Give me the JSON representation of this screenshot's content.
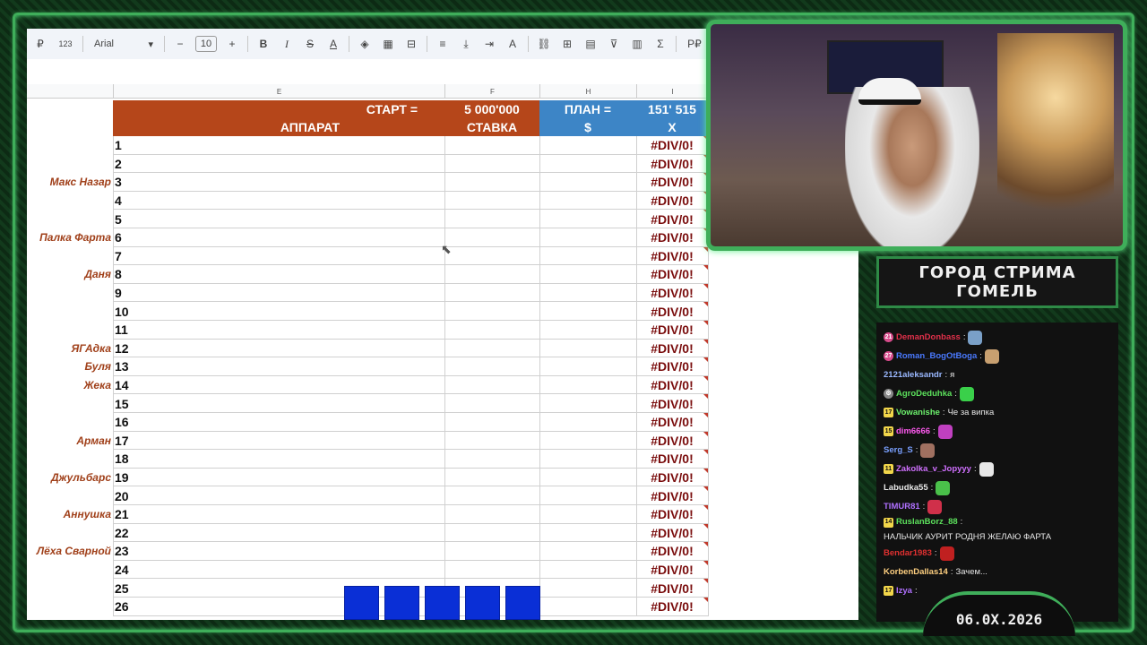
{
  "toolbar": {
    "format_label": "123",
    "font": "Arial",
    "font_size": "10",
    "currency_label": "Р₽",
    "sigma": "Σ"
  },
  "columns": [
    "E",
    "F",
    "H",
    "I"
  ],
  "sheet_header": {
    "start_label": "СТАРТ =",
    "start_value": "5 000'000",
    "plan_label": "ПЛАН =",
    "plan_value": "151' 515",
    "col_apparat": "АППАРАТ",
    "col_stavka": "СТАВКА",
    "col_dollar": "$",
    "col_x": "X"
  },
  "rows": [
    {
      "num": "1",
      "x": "#DIV/0!"
    },
    {
      "num": "2",
      "x": "#DIV/0!"
    },
    {
      "num": "3",
      "x": "#DIV/0!"
    },
    {
      "num": "4",
      "x": "#DIV/0!"
    },
    {
      "num": "5",
      "x": "#DIV/0!"
    },
    {
      "num": "6",
      "x": "#DIV/0!"
    },
    {
      "num": "7",
      "x": "#DIV/0!"
    },
    {
      "num": "8",
      "x": "#DIV/0!"
    },
    {
      "num": "9",
      "x": "#DIV/0!"
    },
    {
      "num": "10",
      "x": "#DIV/0!"
    },
    {
      "num": "11",
      "x": "#DIV/0!"
    },
    {
      "num": "12",
      "x": "#DIV/0!"
    },
    {
      "num": "13",
      "x": "#DIV/0!"
    },
    {
      "num": "14",
      "x": "#DIV/0!"
    },
    {
      "num": "15",
      "x": "#DIV/0!"
    },
    {
      "num": "16",
      "x": "#DIV/0!"
    },
    {
      "num": "17",
      "x": "#DIV/0!"
    },
    {
      "num": "18",
      "x": "#DIV/0!"
    },
    {
      "num": "19",
      "x": "#DIV/0!"
    },
    {
      "num": "20",
      "x": "#DIV/0!"
    },
    {
      "num": "21",
      "x": "#DIV/0!"
    },
    {
      "num": "22",
      "x": "#DIV/0!"
    },
    {
      "num": "23",
      "x": "#DIV/0!"
    },
    {
      "num": "24",
      "x": "#DIV/0!"
    },
    {
      "num": "25",
      "x": "#DIV/0!"
    },
    {
      "num": "26",
      "x": "#DIV/0!"
    }
  ],
  "names": [
    {
      "row": 3,
      "name": "Макс Назар"
    },
    {
      "row": 6,
      "name": "Палка Фарта"
    },
    {
      "row": 8,
      "name": "Даня"
    },
    {
      "row": 12,
      "name": "ЯГАдка"
    },
    {
      "row": 13,
      "name": "Буля"
    },
    {
      "row": 14,
      "name": "Жека"
    },
    {
      "row": 17,
      "name": "Арман"
    },
    {
      "row": 19,
      "name": "Джульбарс"
    },
    {
      "row": 21,
      "name": "Аннушка"
    },
    {
      "row": 23,
      "name": "Лёха Сварной"
    }
  ],
  "title_plate": {
    "line1": "ГОРОД СТРИМА",
    "line2": "ГОМЕЛЬ"
  },
  "chat": [
    {
      "badge": "21",
      "badge_type": "pink",
      "user": "DemanDonbass",
      "color": "#e0304a",
      "text": "",
      "emote": "#7aa0c8"
    },
    {
      "badge": "27",
      "badge_type": "pink",
      "user": "Roman_BogOtBoga",
      "color": "#4a7aff",
      "text": "",
      "emote": "#c8a070"
    },
    {
      "badge": "",
      "badge_type": "",
      "user": "2121aleksandr",
      "color": "#9ab8ff",
      "text": "я",
      "emote": ""
    },
    {
      "badge": "⚙",
      "badge_type": "grey",
      "user": "AgroDeduhka",
      "color": "#5ce05c",
      "text": "",
      "emote": "#3ad04a"
    },
    {
      "badge": "17",
      "badge_type": "",
      "user": "Vowanishe",
      "color": "#6cf06c",
      "text": "Че за випка",
      "emote": ""
    },
    {
      "badge": "15",
      "badge_type": "",
      "user": "dim6666",
      "color": "#ff5af0",
      "text": "",
      "emote": "#c040c0"
    },
    {
      "badge": "",
      "badge_type": "",
      "user": "Serg_S",
      "color": "#7aa0ff",
      "text": "",
      "emote": "#a07060"
    },
    {
      "badge": "11",
      "badge_type": "",
      "user": "Zakolka_v_Jopyyy",
      "color": "#d070ff",
      "text": "",
      "emote": "#e8e8e8"
    },
    {
      "badge": "",
      "badge_type": "",
      "user": "Labudka55",
      "color": "#e8e8e8",
      "text": "",
      "emote": "#4ac04a"
    },
    {
      "badge": "",
      "badge_type": "",
      "user": "TIMUR81",
      "color": "#b070ff",
      "text": "",
      "emote": "#d0304a"
    },
    {
      "badge": "14",
      "badge_type": "",
      "user": "RuslanBorz_88",
      "color": "#5ce05c",
      "text": "НАЛЬЧИК АУРИТ РОДНЯ ЖЕЛАЮ ФАРТА",
      "emote": ""
    },
    {
      "badge": "",
      "badge_type": "",
      "user": "Bendar1983",
      "color": "#e03030",
      "text": "",
      "emote": "#c02020"
    },
    {
      "badge": "",
      "badge_type": "",
      "user": "KorbenDallas14",
      "color": "#ffd080",
      "text": "Зачем...",
      "emote": ""
    },
    {
      "badge": "17",
      "badge_type": "",
      "user": "Izya",
      "color": "#b070ff",
      "text": "",
      "emote": ""
    }
  ],
  "date": "06.0X.2026"
}
